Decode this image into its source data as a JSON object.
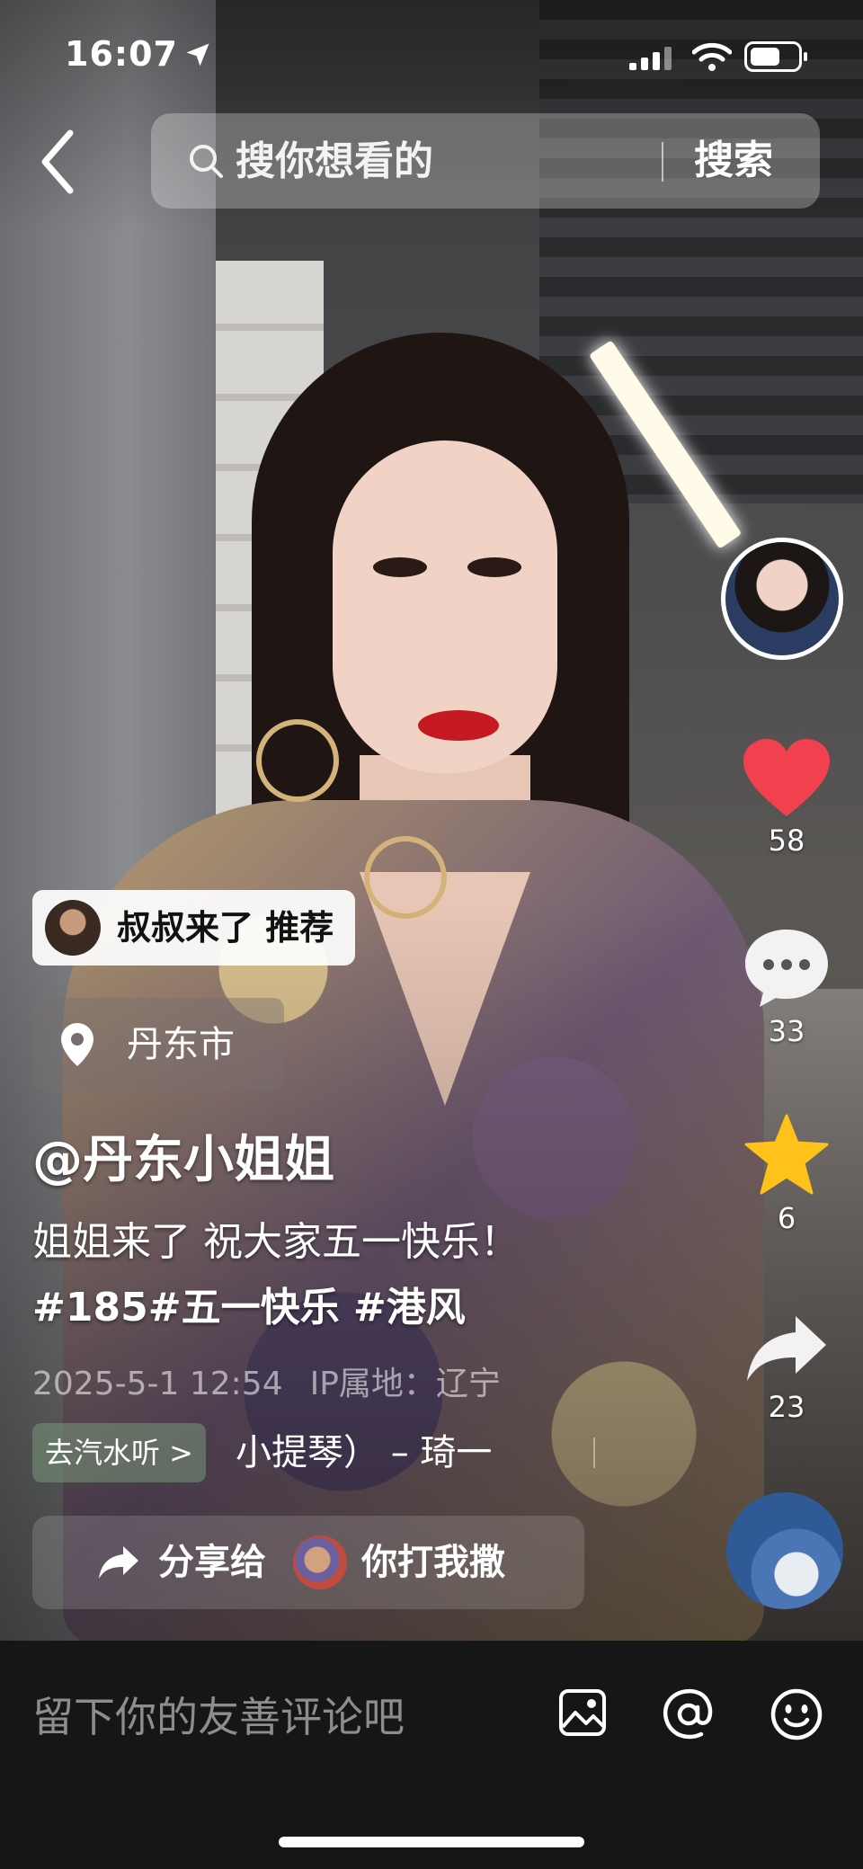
{
  "status_bar": {
    "time": "16:07"
  },
  "search": {
    "placeholder": "搜你想看的",
    "button_label": "搜索"
  },
  "actions": {
    "likes": "58",
    "comments": "33",
    "favorites": "6",
    "shares": "23"
  },
  "recommend_chip": {
    "label": "叔叔来了 推荐"
  },
  "location": {
    "label": "丹东市"
  },
  "author": {
    "handle": "@丹东小姐姐"
  },
  "caption": {
    "line1": "姐姐来了 祝大家五一快乐！",
    "line2": "#185#五一快乐 #港风"
  },
  "meta": {
    "datetime": "2025-5-1 12:54",
    "ip_label": "IP属地：辽宁"
  },
  "music": {
    "chip_label": "去汽水听 >",
    "title": "小提琴） – 琦一"
  },
  "share_bar": {
    "prefix": "分享给",
    "friend": "你打我撒"
  },
  "comment_bar": {
    "placeholder": "留下你的友善评论吧"
  }
}
